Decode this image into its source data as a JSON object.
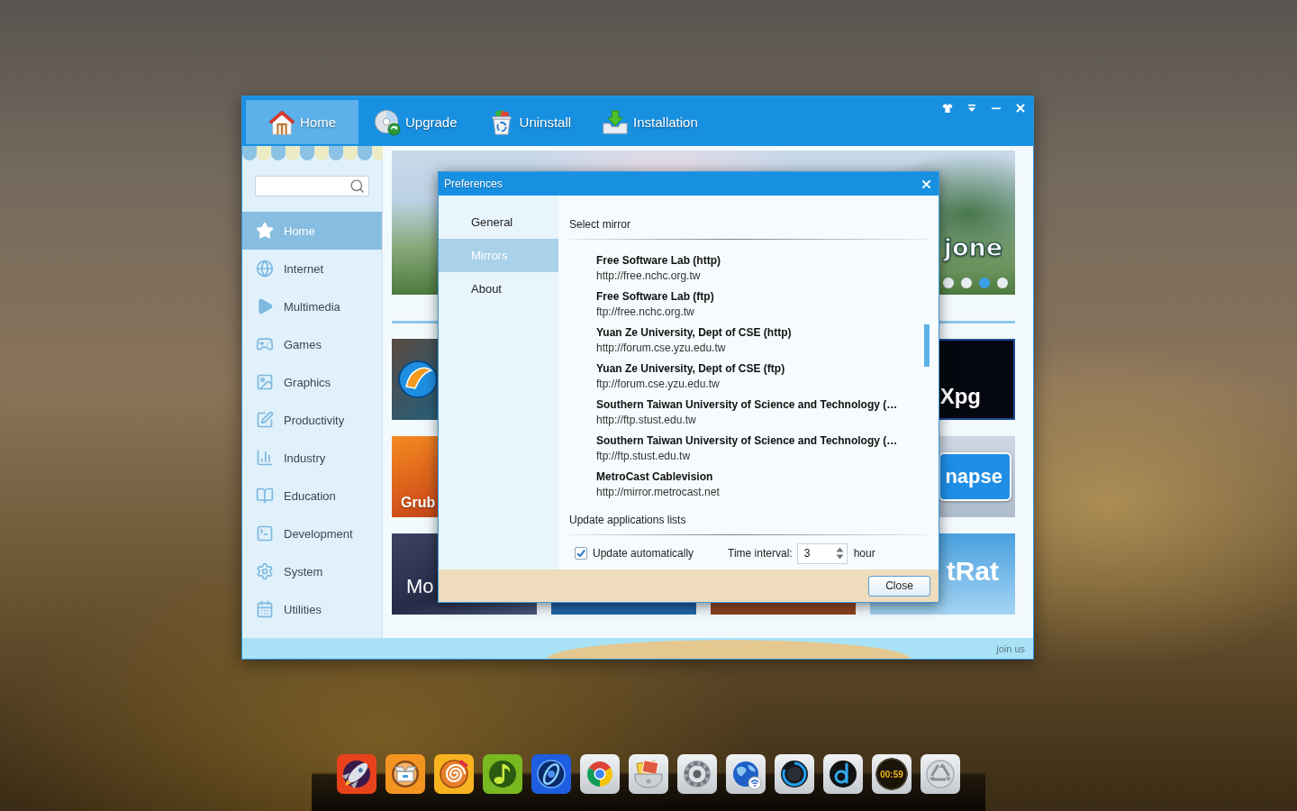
{
  "app_window": {
    "tabs": [
      {
        "label": "Home",
        "selected": true
      },
      {
        "label": "Upgrade",
        "selected": false
      },
      {
        "label": "Uninstall",
        "selected": false
      },
      {
        "label": "Installation",
        "selected": false
      }
    ],
    "sidebar": {
      "items": [
        {
          "label": "Home",
          "selected": true
        },
        {
          "label": "Internet",
          "selected": false
        },
        {
          "label": "Multimedia",
          "selected": false
        },
        {
          "label": "Games",
          "selected": false
        },
        {
          "label": "Graphics",
          "selected": false
        },
        {
          "label": "Productivity",
          "selected": false
        },
        {
          "label": "Industry",
          "selected": false
        },
        {
          "label": "Education",
          "selected": false
        },
        {
          "label": "Development",
          "selected": false
        },
        {
          "label": "System",
          "selected": false
        },
        {
          "label": "Utilities",
          "selected": false
        }
      ]
    },
    "banner": {
      "title": "jone",
      "dots": [
        {
          "selected": false
        },
        {
          "selected": false
        },
        {
          "selected": true
        },
        {
          "selected": false
        }
      ]
    },
    "tiles": [
      {
        "kind": "ball"
      },
      {
        "kind": "night",
        "label": "Xpg"
      },
      {
        "kind": "sunset",
        "label": "Grub"
      },
      {
        "kind": "synapse",
        "label": "napse"
      },
      {
        "kind": "space",
        "label": "Mo"
      },
      {
        "kind": "screen"
      },
      {
        "kind": "desert"
      },
      {
        "kind": "sky",
        "label": "tRat"
      }
    ],
    "footer": {
      "link": "join us"
    }
  },
  "preferences_dialog": {
    "title": "Preferences",
    "nav": [
      {
        "label": "General",
        "selected": false
      },
      {
        "label": "Mirrors",
        "selected": true
      },
      {
        "label": "About",
        "selected": false
      }
    ],
    "mirror_section": {
      "heading": "Select mirror",
      "mirrors": [
        {
          "name": "Free Software Lab (http)",
          "url": "http://free.nchc.org.tw"
        },
        {
          "name": "Free Software Lab (ftp)",
          "url": "ftp://free.nchc.org.tw"
        },
        {
          "name": "Yuan Ze University, Dept of CSE (http)",
          "url": "http://forum.cse.yzu.edu.tw"
        },
        {
          "name": "Yuan Ze University, Dept of CSE (ftp)",
          "url": "ftp://forum.cse.yzu.edu.tw"
        },
        {
          "name": "Southern Taiwan University of Science and Technology (…",
          "url": "http://ftp.stust.edu.tw"
        },
        {
          "name": "Southern Taiwan University of Science and Technology (…",
          "url": "ftp://ftp.stust.edu.tw"
        },
        {
          "name": "MetroCast Cablevision",
          "url": "http://mirror.metrocast.net"
        }
      ]
    },
    "update_section": {
      "heading": "Update applications lists",
      "auto_update": {
        "label": "Update automatically",
        "checked": true
      },
      "interval": {
        "label": "Time interval:",
        "value": "3",
        "unit": "hour"
      }
    },
    "buttons": [
      "Close"
    ]
  },
  "dock": {
    "clock": "00:59"
  }
}
